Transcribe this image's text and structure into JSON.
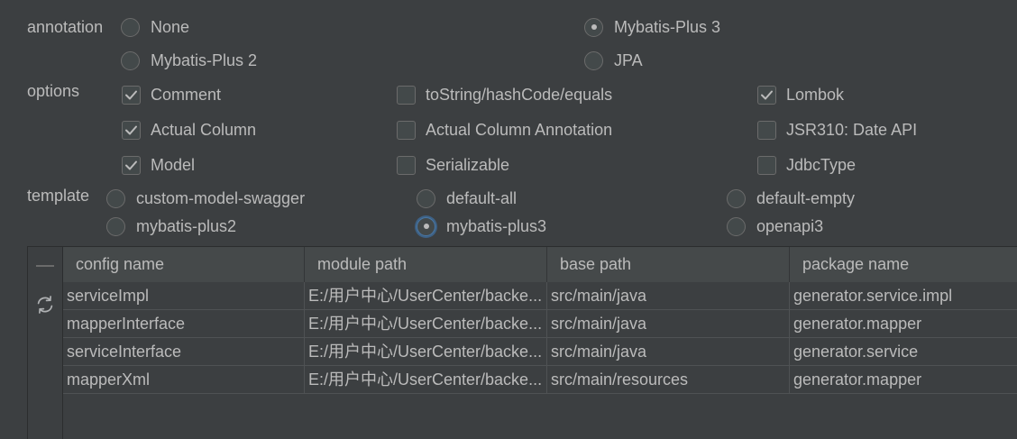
{
  "colors": {
    "background": "#3c3f41",
    "text": "#bbbbbb",
    "header_background": "#45494a",
    "focus_ring": "#3d6185"
  },
  "annotation": {
    "label": "annotation",
    "options": [
      {
        "label": "None",
        "selected": false
      },
      {
        "label": "Mybatis-Plus 3",
        "selected": true
      },
      {
        "label": "Mybatis-Plus 2",
        "selected": false
      },
      {
        "label": "JPA",
        "selected": false
      }
    ]
  },
  "options": {
    "label": "options",
    "items": [
      {
        "label": "Comment",
        "checked": true
      },
      {
        "label": "toString/hashCode/equals",
        "checked": false
      },
      {
        "label": "Lombok",
        "checked": true
      },
      {
        "label": "Actual Column",
        "checked": true
      },
      {
        "label": "Actual Column Annotation",
        "checked": false
      },
      {
        "label": "JSR310: Date API",
        "checked": false
      },
      {
        "label": "Model",
        "checked": true
      },
      {
        "label": "Serializable",
        "checked": false
      },
      {
        "label": "JdbcType",
        "checked": false
      }
    ]
  },
  "template": {
    "label": "template",
    "options": [
      {
        "label": "custom-model-swagger",
        "selected": false
      },
      {
        "label": "default-all",
        "selected": false
      },
      {
        "label": "default-empty",
        "selected": false
      },
      {
        "label": "mybatis-plus2",
        "selected": false
      },
      {
        "label": "mybatis-plus3",
        "selected": true,
        "focused": true
      },
      {
        "label": "openapi3",
        "selected": false
      }
    ]
  },
  "table": {
    "toolbar": {
      "remove_button": {
        "icon": "minus-icon",
        "enabled": false
      },
      "refresh_button": {
        "icon": "refresh-icon",
        "enabled": true
      }
    },
    "columns": [
      "config name",
      "module path",
      "base path",
      "package name"
    ],
    "rows": [
      [
        "serviceImpl",
        "E:/用户中心/UserCenter/backe...",
        "src/main/java",
        "generator.service.impl"
      ],
      [
        "mapperInterface",
        "E:/用户中心/UserCenter/backe...",
        "src/main/java",
        "generator.mapper"
      ],
      [
        "serviceInterface",
        "E:/用户中心/UserCenter/backe...",
        "src/main/java",
        "generator.service"
      ],
      [
        "mapperXml",
        "E:/用户中心/UserCenter/backe...",
        "src/main/resources",
        "generator.mapper"
      ]
    ]
  }
}
